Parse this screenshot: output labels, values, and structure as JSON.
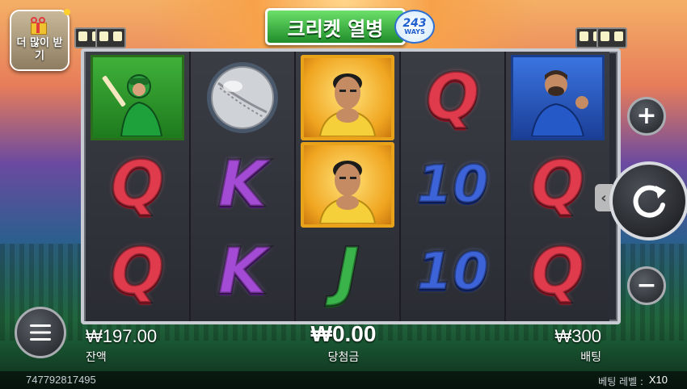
{
  "game": {
    "logo_text": "크리켓 열병",
    "logo_badge_num": "243",
    "logo_badge_word": "WAYS"
  },
  "promo": {
    "label": "더 많이 받기"
  },
  "reels": [
    [
      "batsman",
      "Q",
      "Q"
    ],
    [
      "cricket-ball",
      "K",
      "K"
    ],
    [
      "captain",
      "captain",
      "J"
    ],
    [
      "Q",
      "10",
      "10"
    ],
    [
      "bowler",
      "Q",
      "Q"
    ]
  ],
  "hud": {
    "balance_value": "₩197.00",
    "balance_label": "잔액",
    "win_value": "₩0.00",
    "win_label": "당첨금",
    "bet_value": "₩300",
    "bet_label": "배팅"
  },
  "footer": {
    "session_id": "747792817495",
    "bet_level_label": "베팅 레벨 :",
    "bet_level_value": "X10"
  },
  "colors": {
    "q": "#e03a4d",
    "k": "#a34bd4",
    "ten": "#3c63d8",
    "j": "#39b34a",
    "gold_frame": "#e8a31b"
  },
  "icons": [
    "menu-icon",
    "plus-icon",
    "minus-icon",
    "spin-icon",
    "chevron-left-icon"
  ]
}
